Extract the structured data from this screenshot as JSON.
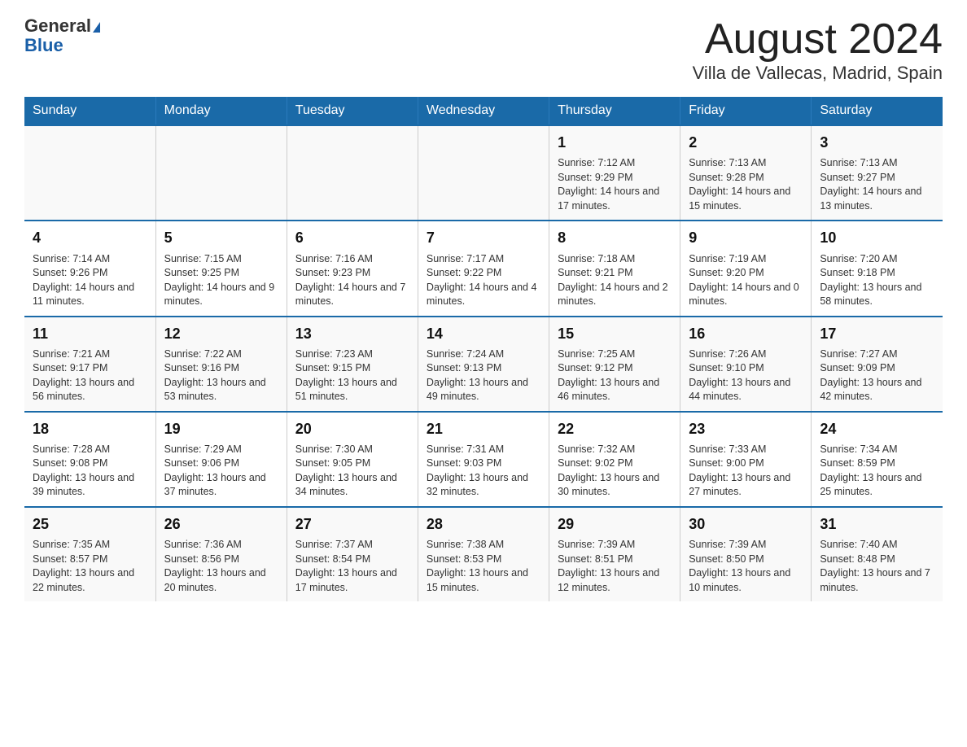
{
  "header": {
    "logo_general": "General",
    "logo_blue": "Blue",
    "title": "August 2024",
    "subtitle": "Villa de Vallecas, Madrid, Spain"
  },
  "weekdays": [
    "Sunday",
    "Monday",
    "Tuesday",
    "Wednesday",
    "Thursday",
    "Friday",
    "Saturday"
  ],
  "weeks": [
    [
      {
        "day": "",
        "info": ""
      },
      {
        "day": "",
        "info": ""
      },
      {
        "day": "",
        "info": ""
      },
      {
        "day": "",
        "info": ""
      },
      {
        "day": "1",
        "info": "Sunrise: 7:12 AM\nSunset: 9:29 PM\nDaylight: 14 hours and 17 minutes."
      },
      {
        "day": "2",
        "info": "Sunrise: 7:13 AM\nSunset: 9:28 PM\nDaylight: 14 hours and 15 minutes."
      },
      {
        "day": "3",
        "info": "Sunrise: 7:13 AM\nSunset: 9:27 PM\nDaylight: 14 hours and 13 minutes."
      }
    ],
    [
      {
        "day": "4",
        "info": "Sunrise: 7:14 AM\nSunset: 9:26 PM\nDaylight: 14 hours and 11 minutes."
      },
      {
        "day": "5",
        "info": "Sunrise: 7:15 AM\nSunset: 9:25 PM\nDaylight: 14 hours and 9 minutes."
      },
      {
        "day": "6",
        "info": "Sunrise: 7:16 AM\nSunset: 9:23 PM\nDaylight: 14 hours and 7 minutes."
      },
      {
        "day": "7",
        "info": "Sunrise: 7:17 AM\nSunset: 9:22 PM\nDaylight: 14 hours and 4 minutes."
      },
      {
        "day": "8",
        "info": "Sunrise: 7:18 AM\nSunset: 9:21 PM\nDaylight: 14 hours and 2 minutes."
      },
      {
        "day": "9",
        "info": "Sunrise: 7:19 AM\nSunset: 9:20 PM\nDaylight: 14 hours and 0 minutes."
      },
      {
        "day": "10",
        "info": "Sunrise: 7:20 AM\nSunset: 9:18 PM\nDaylight: 13 hours and 58 minutes."
      }
    ],
    [
      {
        "day": "11",
        "info": "Sunrise: 7:21 AM\nSunset: 9:17 PM\nDaylight: 13 hours and 56 minutes."
      },
      {
        "day": "12",
        "info": "Sunrise: 7:22 AM\nSunset: 9:16 PM\nDaylight: 13 hours and 53 minutes."
      },
      {
        "day": "13",
        "info": "Sunrise: 7:23 AM\nSunset: 9:15 PM\nDaylight: 13 hours and 51 minutes."
      },
      {
        "day": "14",
        "info": "Sunrise: 7:24 AM\nSunset: 9:13 PM\nDaylight: 13 hours and 49 minutes."
      },
      {
        "day": "15",
        "info": "Sunrise: 7:25 AM\nSunset: 9:12 PM\nDaylight: 13 hours and 46 minutes."
      },
      {
        "day": "16",
        "info": "Sunrise: 7:26 AM\nSunset: 9:10 PM\nDaylight: 13 hours and 44 minutes."
      },
      {
        "day": "17",
        "info": "Sunrise: 7:27 AM\nSunset: 9:09 PM\nDaylight: 13 hours and 42 minutes."
      }
    ],
    [
      {
        "day": "18",
        "info": "Sunrise: 7:28 AM\nSunset: 9:08 PM\nDaylight: 13 hours and 39 minutes."
      },
      {
        "day": "19",
        "info": "Sunrise: 7:29 AM\nSunset: 9:06 PM\nDaylight: 13 hours and 37 minutes."
      },
      {
        "day": "20",
        "info": "Sunrise: 7:30 AM\nSunset: 9:05 PM\nDaylight: 13 hours and 34 minutes."
      },
      {
        "day": "21",
        "info": "Sunrise: 7:31 AM\nSunset: 9:03 PM\nDaylight: 13 hours and 32 minutes."
      },
      {
        "day": "22",
        "info": "Sunrise: 7:32 AM\nSunset: 9:02 PM\nDaylight: 13 hours and 30 minutes."
      },
      {
        "day": "23",
        "info": "Sunrise: 7:33 AM\nSunset: 9:00 PM\nDaylight: 13 hours and 27 minutes."
      },
      {
        "day": "24",
        "info": "Sunrise: 7:34 AM\nSunset: 8:59 PM\nDaylight: 13 hours and 25 minutes."
      }
    ],
    [
      {
        "day": "25",
        "info": "Sunrise: 7:35 AM\nSunset: 8:57 PM\nDaylight: 13 hours and 22 minutes."
      },
      {
        "day": "26",
        "info": "Sunrise: 7:36 AM\nSunset: 8:56 PM\nDaylight: 13 hours and 20 minutes."
      },
      {
        "day": "27",
        "info": "Sunrise: 7:37 AM\nSunset: 8:54 PM\nDaylight: 13 hours and 17 minutes."
      },
      {
        "day": "28",
        "info": "Sunrise: 7:38 AM\nSunset: 8:53 PM\nDaylight: 13 hours and 15 minutes."
      },
      {
        "day": "29",
        "info": "Sunrise: 7:39 AM\nSunset: 8:51 PM\nDaylight: 13 hours and 12 minutes."
      },
      {
        "day": "30",
        "info": "Sunrise: 7:39 AM\nSunset: 8:50 PM\nDaylight: 13 hours and 10 minutes."
      },
      {
        "day": "31",
        "info": "Sunrise: 7:40 AM\nSunset: 8:48 PM\nDaylight: 13 hours and 7 minutes."
      }
    ]
  ]
}
